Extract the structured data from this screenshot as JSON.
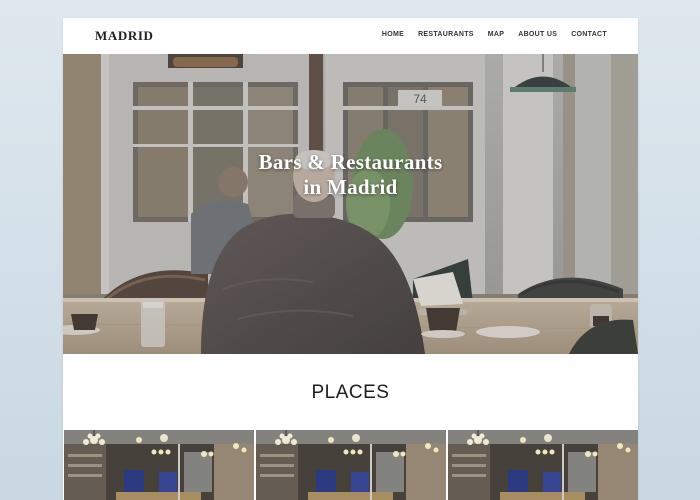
{
  "site": {
    "logo": "MADRID"
  },
  "nav": {
    "items": [
      "HOME",
      "RESTAURANTS",
      "MAP",
      "ABOUT US",
      "CONTACT"
    ]
  },
  "hero": {
    "title_line1": "Bars & Restaurants",
    "title_line2": "in Madrid",
    "sign_number": "74"
  },
  "places": {
    "heading": "PLACES"
  },
  "colors": {
    "page_bg": "#ffffff",
    "backdrop": "#d4e0e8",
    "heading_text": "#1d1d1d"
  }
}
